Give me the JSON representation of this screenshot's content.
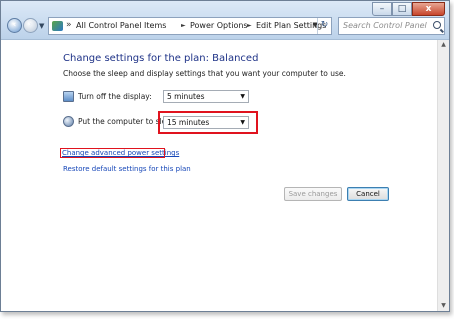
{
  "window": {
    "controls": {
      "minimize": "–",
      "maximize": "□",
      "close": "x"
    }
  },
  "nav": {
    "back_icon": "back-arrow-icon",
    "forward_icon": "forward-arrow-icon",
    "back_glyph": "‹",
    "forward_glyph": "›"
  },
  "breadcrumb": {
    "separator": "»",
    "chevron": "►",
    "items": [
      "All Control Panel Items",
      "Power Options",
      "Edit Plan Settings"
    ]
  },
  "search": {
    "placeholder": "Search Control Panel"
  },
  "main": {
    "title": "Change settings for the plan: Balanced",
    "subtitle": "Choose the sleep and display settings that you want your computer to use.",
    "settings": [
      {
        "label": "Turn off the display:",
        "value": "5 minutes",
        "icon": "monitor-icon"
      },
      {
        "label": "Put the computer to sleep:",
        "value": "15 minutes",
        "icon": "moon-icon"
      }
    ],
    "links": {
      "advanced": "Change advanced power settings",
      "restore": "Restore default settings for this plan"
    },
    "buttons": {
      "save": "Save changes",
      "cancel": "Cancel"
    }
  },
  "colors": {
    "heading": "#1e3287",
    "link": "#1747b8",
    "highlight": "#e0131e"
  }
}
